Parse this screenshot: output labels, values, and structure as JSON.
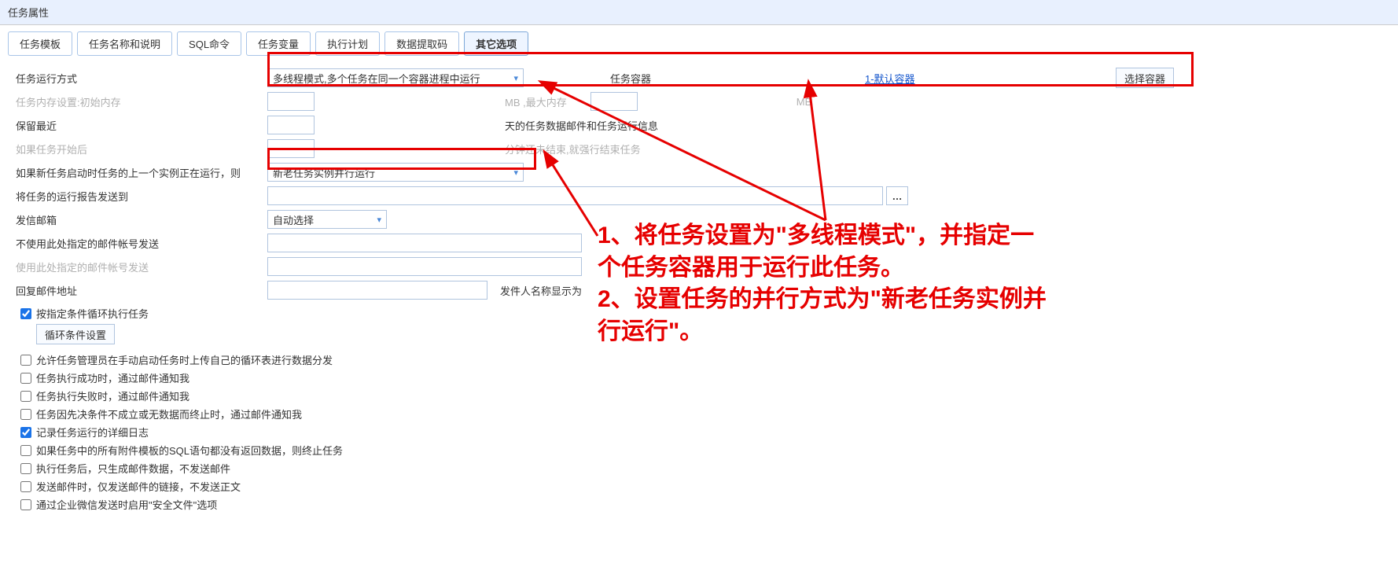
{
  "panel_title": "任务属性",
  "tabs": [
    "任务模板",
    "任务名称和说明",
    "SQL命令",
    "任务变量",
    "执行计划",
    "数据提取码",
    "其它选项"
  ],
  "active_tab_index": 6,
  "form": {
    "run_mode_label": "任务运行方式",
    "run_mode_value": "多线程模式,多个任务在同一个容器进程中运行",
    "container_label": "任务容器",
    "container_link": "1-默认容器",
    "container_btn": "选择容器",
    "mem_label": "任务内存设置:初始内存",
    "mem_unit1": "MB ,最大内存",
    "mem_unit2": "MB",
    "keep_label": "保留最近",
    "keep_suffix": "天的任务数据邮件和任务运行信息",
    "timeout_label": "如果任务开始后",
    "timeout_suffix": "分钟还未结束,就强行结束任务",
    "concurrent_label": "如果新任务启动时任务的上一个实例正在运行，则",
    "concurrent_value": "新老任务实例并行运行",
    "report_label": "将任务的运行报告发送到",
    "sender_label": "发信邮箱",
    "sender_value": "自动选择",
    "nouse_label": "不使用此处指定的邮件帐号发送",
    "use_label": "使用此处指定的邮件帐号发送",
    "reply_label": "回复邮件地址",
    "sendername_label": "发件人名称显示为"
  },
  "checkboxes": {
    "loop": {
      "label": "按指定条件循环执行任务",
      "checked": true
    },
    "loop_btn": "循环条件设置",
    "c1": {
      "label": "允许任务管理员在手动启动任务时上传自己的循环表进行数据分发",
      "checked": false
    },
    "c2": {
      "label": "任务执行成功时，通过邮件通知我",
      "checked": false
    },
    "c3": {
      "label": "任务执行失败时，通过邮件通知我",
      "checked": false
    },
    "c4": {
      "label": "任务因先决条件不成立或无数据而终止时，通过邮件通知我",
      "checked": false
    },
    "c5": {
      "label": "记录任务运行的详细日志",
      "checked": true
    },
    "c6": {
      "label": "如果任务中的所有附件模板的SQL语句都没有返回数据，则终止任务",
      "checked": false
    },
    "c7": {
      "label": "执行任务后，只生成邮件数据，不发送邮件",
      "checked": false
    },
    "c8": {
      "label": "发送邮件时，仅发送邮件的链接，不发送正文",
      "checked": false
    },
    "c9": {
      "label": "通过企业微信发送时启用\"安全文件\"选项",
      "checked": false
    }
  },
  "annotation": {
    "line1": "1、将任务设置为\"多线程模式\"，并指定一",
    "line2": "个任务容器用于运行此任务。",
    "line3": "2、设置任务的并行方式为\"新老任务实例并",
    "line4": "行运行\"。"
  }
}
